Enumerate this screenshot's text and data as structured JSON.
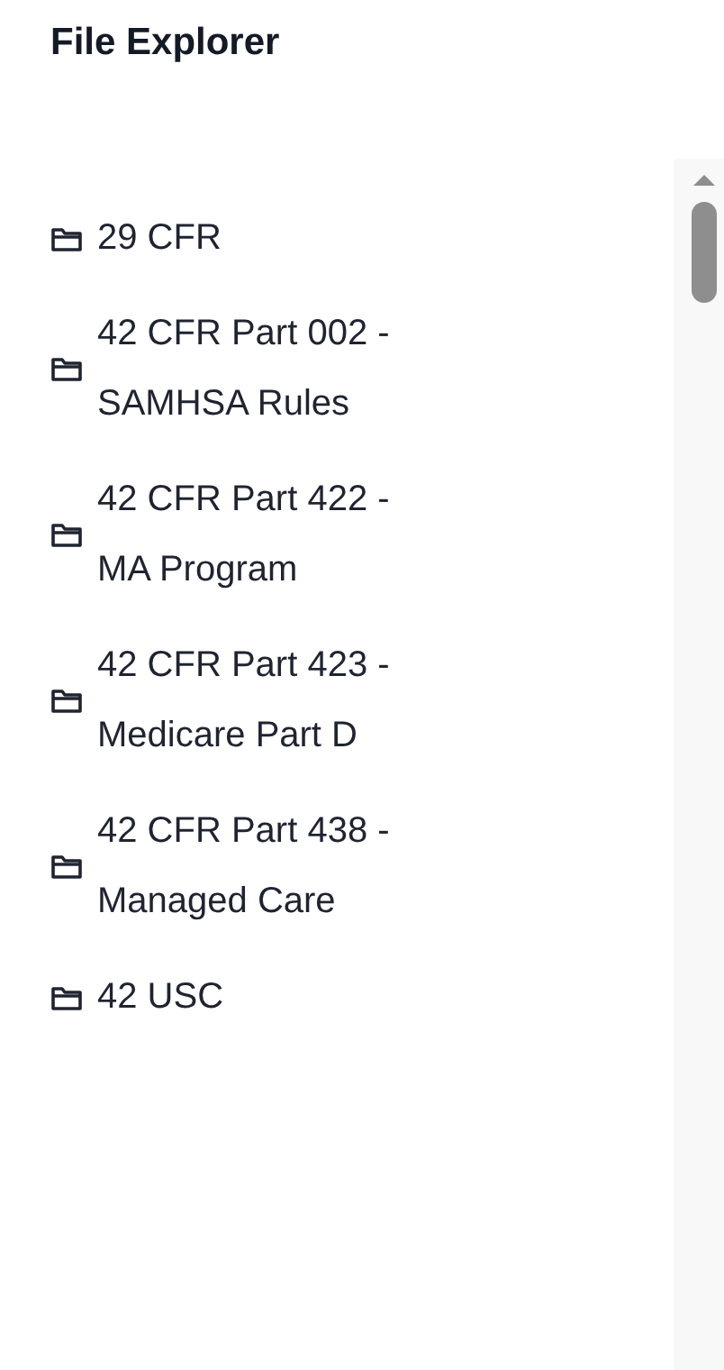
{
  "title": "File Explorer",
  "folders": [
    {
      "name": "29 CFR"
    },
    {
      "name": "42 CFR Part 002 - SAMHSA Rules"
    },
    {
      "name": "42 CFR Part 422 - MA Program"
    },
    {
      "name": "42 CFR Part 423 - Medicare Part D"
    },
    {
      "name": "42 CFR Part 438 - Managed Care"
    },
    {
      "name": "42 USC"
    }
  ]
}
